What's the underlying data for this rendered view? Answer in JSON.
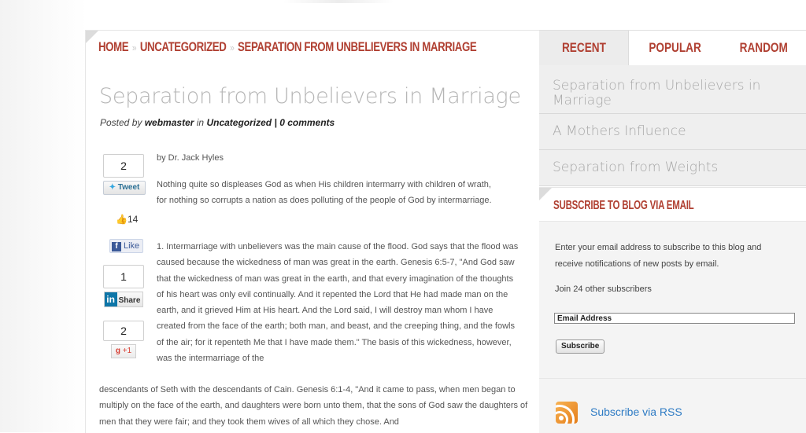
{
  "breadcrumb": {
    "home": "HOME",
    "sep": "»",
    "category": "UNCATEGORIZED",
    "current": "SEPARATION FROM UNBELIEVERS IN MARRIAGE"
  },
  "post": {
    "title": "Separation from Unbelievers in Marriage",
    "meta_prefix": "Posted by",
    "author": "webmaster",
    "meta_in": "in",
    "category": "Uncategorized",
    "meta_sep": "|",
    "comments": "0 comments",
    "byline": "by Dr. Jack Hyles",
    "paragraph1": "Nothing quite so displeases God as when His children intermarry with children of wrath, for nothing so corrupts a nation as does polluting of the people of God by intermarriage.",
    "paragraph2": "1. Intermarriage with unbelievers was the main cause of the flood. God says that the flood was caused because the wickedness of man was great in the earth. Genesis 6:5-7, \"And God saw that the wickedness of man was great in the earth, and that every imagination of the thoughts of his heart was only evil continually. And it repented the Lord that He had made man on the earth, and it grieved Him at His heart. And the Lord said, I will destroy man whom I have created from the face of the earth; both man, and beast, and the creeping thing, and the fowls of the air; for it repenteth Me that I have made them.\" The basis of this wickedness, however, was the intermarriage of the",
    "paragraph3": "descendants of Seth with the descendants of Cain. Genesis 6:1-4, \"And it came to pass, when men began to multiply on the face of the earth, and daughters were born unto them, that the sons of God saw the daughters of men that they were fair; and they took them wives of all which they chose. And"
  },
  "share": {
    "tweet_count": "2",
    "tweet_label": "Tweet",
    "like_count": "14",
    "like_label": "Like",
    "linkedin_count": "1",
    "linkedin_label": "Share",
    "gplus_count": "2",
    "gplus_label": "+1"
  },
  "sidebar": {
    "tabs": [
      {
        "label": "RECENT"
      },
      {
        "label": "POPULAR"
      },
      {
        "label": "RANDOM"
      }
    ],
    "recent": [
      {
        "title": "Separation from Unbelievers in Marriage"
      },
      {
        "title": "A Mothers Influence"
      },
      {
        "title": "Separation from Weights"
      }
    ],
    "subscribe": {
      "heading": "SUBSCRIBE TO BLOG VIA EMAIL",
      "description": "Enter your email address to subscribe to this blog and receive notifications of new posts by email.",
      "join": "Join 24 other subscribers",
      "email_placeholder": "Email Address",
      "button": "Subscribe"
    },
    "rss": {
      "label": "Subscribe via RSS"
    }
  },
  "colors": {
    "accent": "#b04032",
    "title_gray": "#b5b5b5",
    "link_blue": "#2e7bc4",
    "rss_orange": "#e57e1b"
  }
}
